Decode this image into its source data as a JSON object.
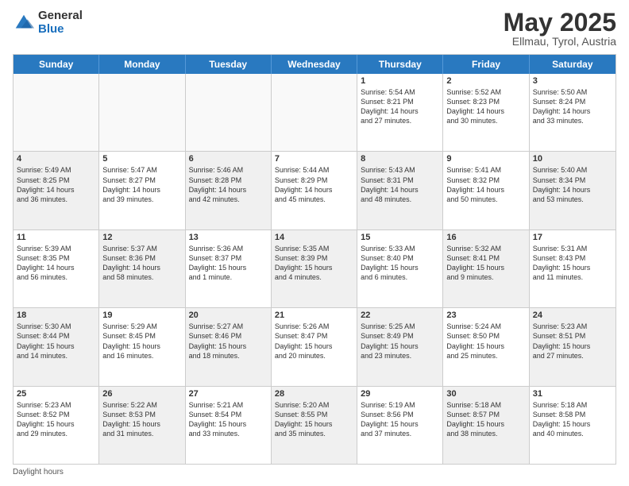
{
  "logo": {
    "general": "General",
    "blue": "Blue"
  },
  "title": {
    "month": "May 2025",
    "location": "Ellmau, Tyrol, Austria"
  },
  "header": {
    "days": [
      "Sunday",
      "Monday",
      "Tuesday",
      "Wednesday",
      "Thursday",
      "Friday",
      "Saturday"
    ]
  },
  "rows": [
    [
      {
        "day": "",
        "text": "",
        "empty": true
      },
      {
        "day": "",
        "text": "",
        "empty": true
      },
      {
        "day": "",
        "text": "",
        "empty": true
      },
      {
        "day": "",
        "text": "",
        "empty": true
      },
      {
        "day": "1",
        "text": "Sunrise: 5:54 AM\nSunset: 8:21 PM\nDaylight: 14 hours\nand 27 minutes."
      },
      {
        "day": "2",
        "text": "Sunrise: 5:52 AM\nSunset: 8:23 PM\nDaylight: 14 hours\nand 30 minutes."
      },
      {
        "day": "3",
        "text": "Sunrise: 5:50 AM\nSunset: 8:24 PM\nDaylight: 14 hours\nand 33 minutes."
      }
    ],
    [
      {
        "day": "4",
        "text": "Sunrise: 5:49 AM\nSunset: 8:25 PM\nDaylight: 14 hours\nand 36 minutes.",
        "shaded": true
      },
      {
        "day": "5",
        "text": "Sunrise: 5:47 AM\nSunset: 8:27 PM\nDaylight: 14 hours\nand 39 minutes."
      },
      {
        "day": "6",
        "text": "Sunrise: 5:46 AM\nSunset: 8:28 PM\nDaylight: 14 hours\nand 42 minutes.",
        "shaded": true
      },
      {
        "day": "7",
        "text": "Sunrise: 5:44 AM\nSunset: 8:29 PM\nDaylight: 14 hours\nand 45 minutes."
      },
      {
        "day": "8",
        "text": "Sunrise: 5:43 AM\nSunset: 8:31 PM\nDaylight: 14 hours\nand 48 minutes.",
        "shaded": true
      },
      {
        "day": "9",
        "text": "Sunrise: 5:41 AM\nSunset: 8:32 PM\nDaylight: 14 hours\nand 50 minutes."
      },
      {
        "day": "10",
        "text": "Sunrise: 5:40 AM\nSunset: 8:34 PM\nDaylight: 14 hours\nand 53 minutes.",
        "shaded": true
      }
    ],
    [
      {
        "day": "11",
        "text": "Sunrise: 5:39 AM\nSunset: 8:35 PM\nDaylight: 14 hours\nand 56 minutes."
      },
      {
        "day": "12",
        "text": "Sunrise: 5:37 AM\nSunset: 8:36 PM\nDaylight: 14 hours\nand 58 minutes.",
        "shaded": true
      },
      {
        "day": "13",
        "text": "Sunrise: 5:36 AM\nSunset: 8:37 PM\nDaylight: 15 hours\nand 1 minute."
      },
      {
        "day": "14",
        "text": "Sunrise: 5:35 AM\nSunset: 8:39 PM\nDaylight: 15 hours\nand 4 minutes.",
        "shaded": true
      },
      {
        "day": "15",
        "text": "Sunrise: 5:33 AM\nSunset: 8:40 PM\nDaylight: 15 hours\nand 6 minutes."
      },
      {
        "day": "16",
        "text": "Sunrise: 5:32 AM\nSunset: 8:41 PM\nDaylight: 15 hours\nand 9 minutes.",
        "shaded": true
      },
      {
        "day": "17",
        "text": "Sunrise: 5:31 AM\nSunset: 8:43 PM\nDaylight: 15 hours\nand 11 minutes."
      }
    ],
    [
      {
        "day": "18",
        "text": "Sunrise: 5:30 AM\nSunset: 8:44 PM\nDaylight: 15 hours\nand 14 minutes.",
        "shaded": true
      },
      {
        "day": "19",
        "text": "Sunrise: 5:29 AM\nSunset: 8:45 PM\nDaylight: 15 hours\nand 16 minutes."
      },
      {
        "day": "20",
        "text": "Sunrise: 5:27 AM\nSunset: 8:46 PM\nDaylight: 15 hours\nand 18 minutes.",
        "shaded": true
      },
      {
        "day": "21",
        "text": "Sunrise: 5:26 AM\nSunset: 8:47 PM\nDaylight: 15 hours\nand 20 minutes."
      },
      {
        "day": "22",
        "text": "Sunrise: 5:25 AM\nSunset: 8:49 PM\nDaylight: 15 hours\nand 23 minutes.",
        "shaded": true
      },
      {
        "day": "23",
        "text": "Sunrise: 5:24 AM\nSunset: 8:50 PM\nDaylight: 15 hours\nand 25 minutes."
      },
      {
        "day": "24",
        "text": "Sunrise: 5:23 AM\nSunset: 8:51 PM\nDaylight: 15 hours\nand 27 minutes.",
        "shaded": true
      }
    ],
    [
      {
        "day": "25",
        "text": "Sunrise: 5:23 AM\nSunset: 8:52 PM\nDaylight: 15 hours\nand 29 minutes."
      },
      {
        "day": "26",
        "text": "Sunrise: 5:22 AM\nSunset: 8:53 PM\nDaylight: 15 hours\nand 31 minutes.",
        "shaded": true
      },
      {
        "day": "27",
        "text": "Sunrise: 5:21 AM\nSunset: 8:54 PM\nDaylight: 15 hours\nand 33 minutes."
      },
      {
        "day": "28",
        "text": "Sunrise: 5:20 AM\nSunset: 8:55 PM\nDaylight: 15 hours\nand 35 minutes.",
        "shaded": true
      },
      {
        "day": "29",
        "text": "Sunrise: 5:19 AM\nSunset: 8:56 PM\nDaylight: 15 hours\nand 37 minutes."
      },
      {
        "day": "30",
        "text": "Sunrise: 5:18 AM\nSunset: 8:57 PM\nDaylight: 15 hours\nand 38 minutes.",
        "shaded": true
      },
      {
        "day": "31",
        "text": "Sunrise: 5:18 AM\nSunset: 8:58 PM\nDaylight: 15 hours\nand 40 minutes."
      }
    ]
  ],
  "footer": {
    "note": "Daylight hours"
  }
}
